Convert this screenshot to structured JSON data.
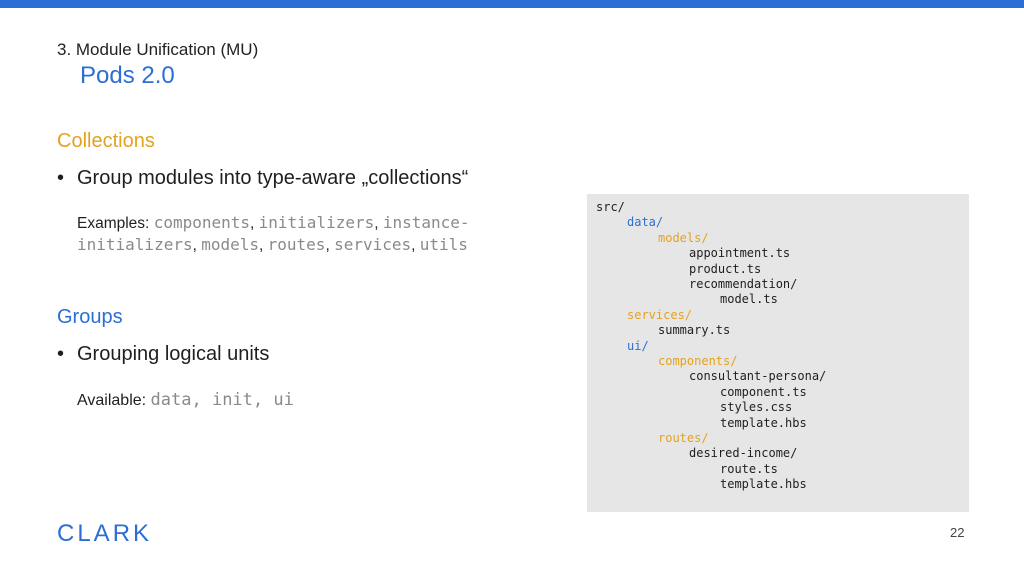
{
  "header": {
    "section_label": "3. Module Unification (MU)",
    "title": "Pods 2.0"
  },
  "collections": {
    "heading": "Collections",
    "bullet": "Group modules into type-aware „collections“",
    "examples_label": "Examples:",
    "examples": [
      "components",
      "initializers",
      "instance-initializers",
      "models",
      "routes",
      "services",
      "utils"
    ]
  },
  "groups": {
    "heading": "Groups",
    "bullet": "Grouping logical units",
    "available_label": "Available:",
    "available_value": "data, init, ui"
  },
  "code_tree": [
    {
      "text": "src/",
      "depth": 0,
      "color": "dark"
    },
    {
      "text": "data/",
      "depth": 1,
      "color": "blue"
    },
    {
      "text": "models/",
      "depth": 2,
      "color": "orange"
    },
    {
      "text": "appointment.ts",
      "depth": 3,
      "color": "dark"
    },
    {
      "text": "product.ts",
      "depth": 3,
      "color": "dark"
    },
    {
      "text": "recommendation/",
      "depth": 3,
      "color": "dark"
    },
    {
      "text": "model.ts",
      "depth": 4,
      "color": "dark"
    },
    {
      "text": "services/",
      "depth": 1,
      "color": "orange"
    },
    {
      "text": "summary.ts",
      "depth": 2,
      "color": "dark"
    },
    {
      "text": "ui/",
      "depth": 1,
      "color": "blue"
    },
    {
      "text": "components/",
      "depth": 2,
      "color": "orange"
    },
    {
      "text": "consultant-persona/",
      "depth": 3,
      "color": "dark"
    },
    {
      "text": "component.ts",
      "depth": 4,
      "color": "dark"
    },
    {
      "text": "styles.css",
      "depth": 4,
      "color": "dark"
    },
    {
      "text": "template.hbs",
      "depth": 4,
      "color": "dark"
    },
    {
      "text": "routes/",
      "depth": 2,
      "color": "orange"
    },
    {
      "text": "desired-income/",
      "depth": 3,
      "color": "dark"
    },
    {
      "text": "route.ts",
      "depth": 4,
      "color": "dark"
    },
    {
      "text": "template.hbs",
      "depth": 4,
      "color": "dark"
    }
  ],
  "footer": {
    "logo": "CLARK",
    "page_number": "22"
  },
  "colors": {
    "accent_blue": "#2b6fd6",
    "accent_orange": "#e3a31e",
    "code_background": "#e6e6e6"
  }
}
